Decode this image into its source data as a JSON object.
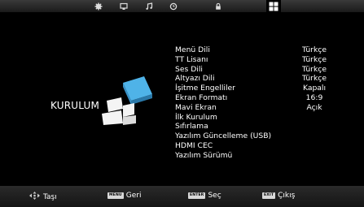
{
  "topbar": {
    "tabs": [
      {
        "icon": "gear-icon"
      },
      {
        "icon": "monitor-icon"
      },
      {
        "icon": "music-note-icon"
      },
      {
        "icon": "clock-icon"
      },
      {
        "icon": "lock-icon"
      },
      {
        "icon": "setup-grid-icon",
        "active": true
      }
    ]
  },
  "section": {
    "title": "KURULUM"
  },
  "menu": {
    "items": [
      {
        "label": "Menü Dili",
        "value": "Türkçe"
      },
      {
        "label": "TT Lisanı",
        "value": "Türkçe"
      },
      {
        "label": "Ses Dili",
        "value": "Türkçe"
      },
      {
        "label": "Altyazı Dili",
        "value": "Türkçe"
      },
      {
        "label": "İşitme Engelliler",
        "value": "Kapalı"
      },
      {
        "label": "Ekran Formatı",
        "value": "16:9"
      },
      {
        "label": "Mavi Ekran",
        "value": "Açık"
      },
      {
        "label": "İlk Kurulum",
        "value": ""
      },
      {
        "label": "Sıfırlama",
        "value": ""
      },
      {
        "label": "Yazılım Güncelleme (USB)",
        "value": ""
      },
      {
        "label": "HDMI CEC",
        "value": ""
      },
      {
        "label": "Yazılım Sürümü",
        "value": ""
      }
    ]
  },
  "bottom": {
    "move": {
      "label": "Taşı"
    },
    "back": {
      "key": "MENU",
      "label": "Geri"
    },
    "select": {
      "key": "ENTER",
      "label": "Seç"
    },
    "exit": {
      "key": "EXIT",
      "label": "Çıkış"
    }
  },
  "colors": {
    "background": "#000000",
    "text": "#ffffff",
    "icon_blue": "#4fb3e8"
  }
}
